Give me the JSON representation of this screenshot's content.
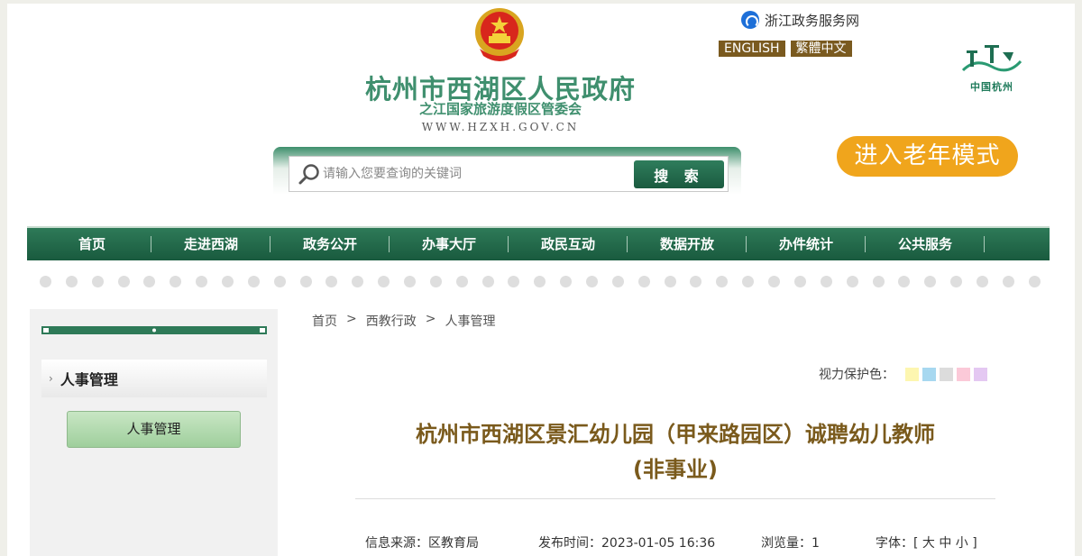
{
  "header": {
    "title": "杭州市西湖区人民政府",
    "subtitle": "之江国家旅游度假区管委会",
    "url": "WWW.HZXH.GOV.CN",
    "zj_link": "浙江政务服务网",
    "lang": [
      "ENGLISH",
      "繁體中文"
    ],
    "city_logo_text": "中国杭州",
    "elder_mode": "进入老年模式"
  },
  "search": {
    "placeholder": "请输入您要查询的关键词",
    "button": "搜 索"
  },
  "nav": {
    "items": [
      "首页",
      "走进西湖",
      "政务公开",
      "办事大厅",
      "政民互动",
      "数据开放",
      "办件统计",
      "公共服务"
    ]
  },
  "sidebar": {
    "heading": "人事管理",
    "button": "人事管理"
  },
  "breadcrumb": [
    "首页",
    "西教行政",
    "人事管理"
  ],
  "breadcrumb_sep": ">",
  "vision": {
    "label": "视力保护色：",
    "colors": [
      "#fdf6b0",
      "#a7d8f0",
      "#dcdcdc",
      "#fbc9d8",
      "#e4c8f2"
    ]
  },
  "article": {
    "title_line1": "杭州市西湖区景汇幼儿园（甲来路园区）诚聘幼儿教师",
    "title_line2": "(非事业)",
    "source": "信息来源：区教育局",
    "publish_time": "发布时间：2023-01-05 16:36",
    "views": "浏览量：1",
    "font_size": "字体：[ 大 中 小 ]"
  },
  "colors": {
    "brand_green": "#2e7a58",
    "title_brown": "#7a5a1c",
    "elder_orange": "#f0a51c"
  }
}
